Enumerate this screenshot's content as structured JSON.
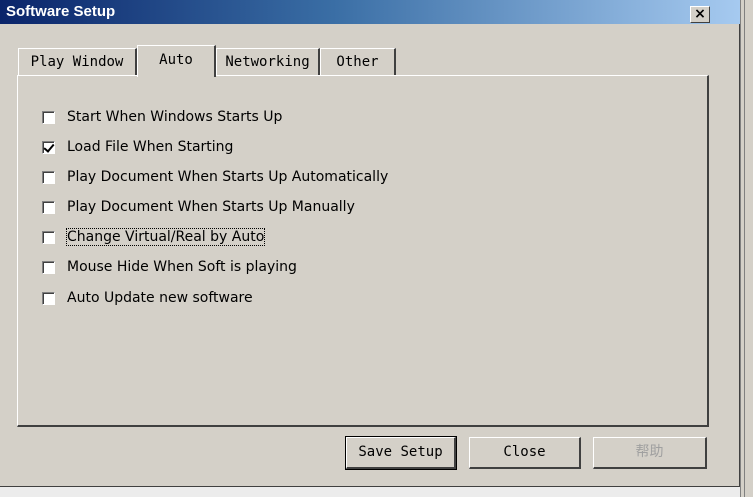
{
  "window": {
    "title": "Software Setup",
    "close_label": "×"
  },
  "tabs": [
    {
      "label": "Play Window",
      "active": false
    },
    {
      "label": "Auto",
      "active": true
    },
    {
      "label": "Networking",
      "active": false
    },
    {
      "label": "Other",
      "active": false
    }
  ],
  "options": [
    {
      "label": "Start When Windows Starts Up",
      "checked": false
    },
    {
      "label": "Load File When Starting",
      "checked": true
    },
    {
      "label": "Play Document When Starts Up Automatically",
      "checked": false
    },
    {
      "label": "Play Document When Starts Up Manually",
      "checked": false
    },
    {
      "label": "Change Virtual/Real by Auto",
      "checked": false,
      "focused": true
    },
    {
      "label": "Mouse Hide When Soft is playing",
      "checked": false
    },
    {
      "label": "Auto Update new software",
      "checked": false
    }
  ],
  "buttons": {
    "save_label": "Save Setup",
    "close_label": "Close",
    "help_label": "帮助"
  }
}
